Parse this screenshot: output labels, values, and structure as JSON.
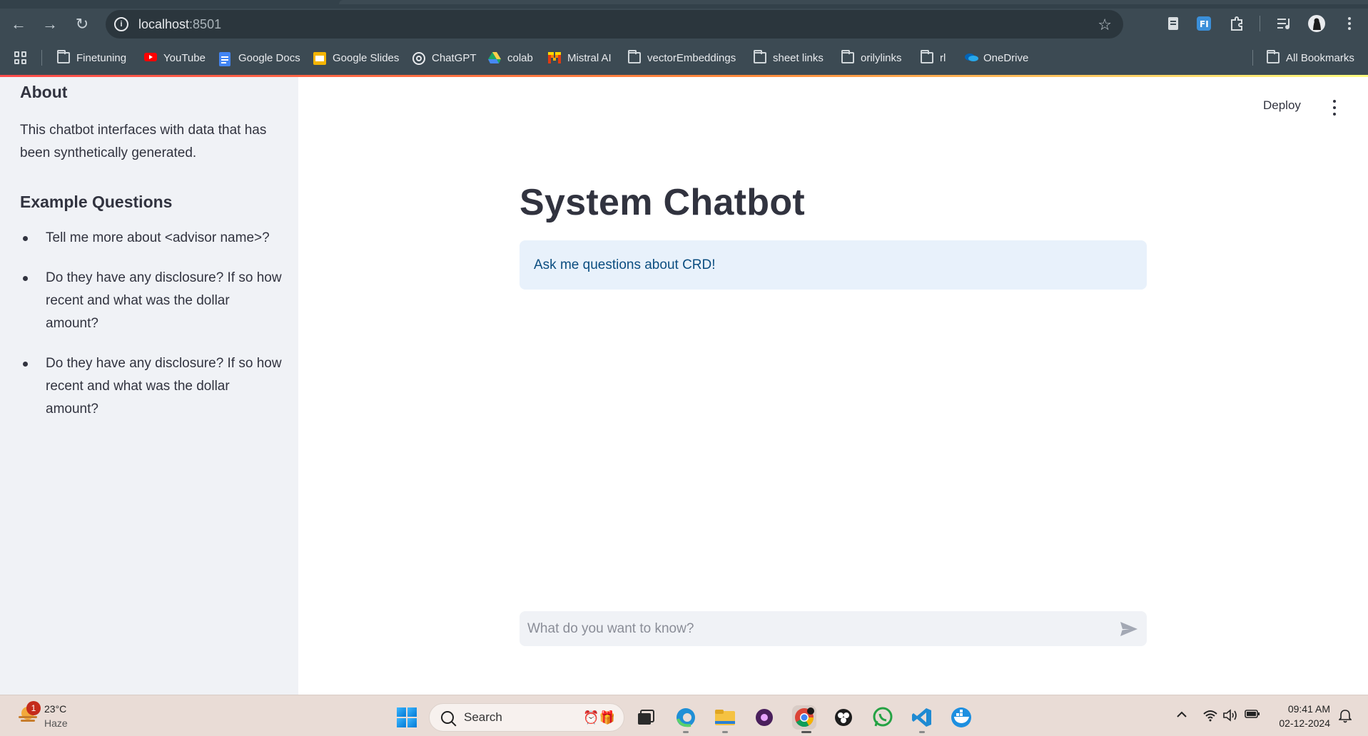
{
  "browser": {
    "url_host": "localhost",
    "url_port": ":8501",
    "bookmarks": [
      {
        "label": "Finetuning",
        "icon": "folder-icon"
      },
      {
        "label": "YouTube",
        "icon": "youtube-icon"
      },
      {
        "label": "Google Docs",
        "icon": "google-docs-icon"
      },
      {
        "label": "Google Slides",
        "icon": "google-slides-icon"
      },
      {
        "label": "ChatGPT",
        "icon": "chatgpt-icon"
      },
      {
        "label": "colab",
        "icon": "drive-icon"
      },
      {
        "label": "Mistral AI",
        "icon": "mistral-icon"
      },
      {
        "label": "vectorEmbeddings",
        "icon": "folder-icon"
      },
      {
        "label": "sheet links",
        "icon": "folder-icon"
      },
      {
        "label": "orilylinks",
        "icon": "folder-icon"
      },
      {
        "label": "rl",
        "icon": "folder-icon"
      },
      {
        "label": "OneDrive",
        "icon": "onedrive-icon"
      }
    ],
    "all_bookmarks": "All Bookmarks"
  },
  "app": {
    "deploy_label": "Deploy",
    "title": "System Chatbot",
    "info_message": "Ask me questions about CRD!",
    "chat_placeholder": "What do you want to know?"
  },
  "sidebar": {
    "about_title": "About",
    "about_text": "This chatbot interfaces with data that has been synthetically generated.",
    "examples_title": "Example Questions",
    "examples": [
      "Tell me more about <advisor name>?",
      "Do they have any disclosure? If so how recent and what was the dollar amount?",
      "Do they have any disclosure? If so how recent and what was the dollar amount?"
    ]
  },
  "taskbar": {
    "weather_badge": "1",
    "temperature": "23°C",
    "condition": "Haze",
    "search_label": "Search",
    "time": "09:41 AM",
    "date": "02-12-2024"
  },
  "colors": {
    "sidebar_bg": "#f0f2f6",
    "info_bg": "#e8f1fb",
    "info_text": "#0b4d80",
    "text": "#31333f",
    "chrome_bg": "#3c4a53"
  }
}
